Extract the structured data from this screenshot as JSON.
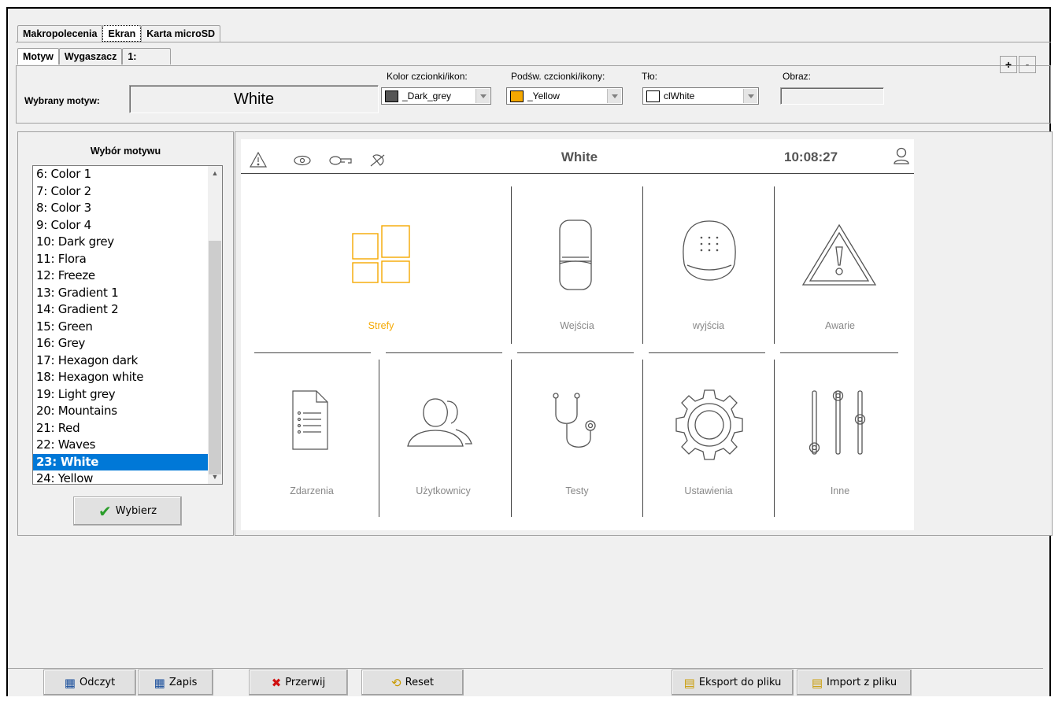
{
  "tabs_top": [
    "Makropolecenia",
    "Ekran",
    "Karta microSD"
  ],
  "tabs_sub": [
    "Motyw",
    "Wygaszacz",
    "1:"
  ],
  "plus_label": "+",
  "minus_label": "-",
  "selected_theme": {
    "label": "Wybrany motyw:",
    "value": "White"
  },
  "font_color": {
    "label": "Kolor czcionki/ikon:",
    "value": "_Dark_grey",
    "swatch": "#555555"
  },
  "highlight": {
    "label": "Podśw. czcionki/ikony:",
    "value": "_Yellow",
    "swatch": "#f5a800"
  },
  "background": {
    "label": "Tło:",
    "value": "clWhite",
    "swatch": "#ffffff"
  },
  "image": {
    "label": "Obraz:",
    "value": ""
  },
  "theme_list": {
    "title": "Wybór motywu",
    "items": [
      "6: Color 1",
      "7: Color 2",
      "8: Color 3",
      "9: Color 4",
      "10: Dark grey",
      "11: Flora",
      "12: Freeze",
      "13: Gradient 1",
      "14: Gradient 2",
      "15: Green",
      "16: Grey",
      "17: Hexagon dark",
      "18: Hexagon white",
      "19: Light grey",
      "20: Mountains",
      "21: Red",
      "22: Waves",
      "23: White",
      "24: Yellow"
    ],
    "selected": "23: White",
    "select_button": "Wybierz"
  },
  "preview": {
    "title": "White",
    "time": "10:08:27",
    "icons": [
      "warning-icon",
      "eye-icon",
      "key-icon",
      "bell-icon",
      "user-icon"
    ],
    "tiles": [
      "Strefy",
      "Wejścia",
      "wyjścia",
      "Awarie",
      "Zdarzenia",
      "Użytkownicy",
      "Testy",
      "Ustawienia",
      "Inne"
    ],
    "accent": "#f5a800"
  },
  "buttons": {
    "read": "Odczyt",
    "write": "Zapis",
    "abort": "Przerwij",
    "reset": "Reset",
    "export": "Eksport do pliku",
    "import": "Import z pliku"
  }
}
